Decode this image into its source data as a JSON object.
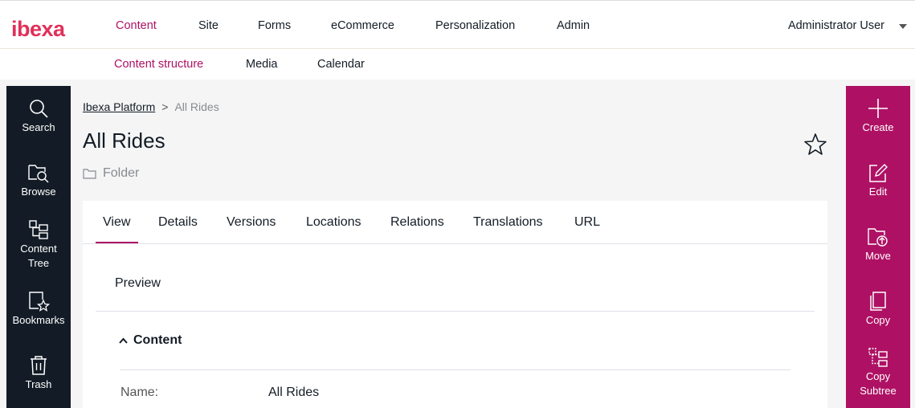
{
  "colors": {
    "accent": "#ae1164",
    "dark": "#131c26",
    "muted": "#878b90"
  },
  "header": {
    "logo_text": "ibexa",
    "nav": [
      "Content",
      "Site",
      "Forms",
      "eCommerce",
      "Personalization",
      "Admin"
    ],
    "user": "Administrator User"
  },
  "subnav": [
    "Content structure",
    "Media",
    "Calendar"
  ],
  "left_sidebar": {
    "items": [
      {
        "label": "Search",
        "icon": "search-icon"
      },
      {
        "label": "Browse",
        "icon": "browse-icon"
      },
      {
        "label": "Content Tree",
        "icon": "content-tree-icon"
      },
      {
        "label": "Bookmarks",
        "icon": "bookmarks-icon"
      },
      {
        "label": "Trash",
        "icon": "trash-icon"
      }
    ]
  },
  "right_sidebar": {
    "items": [
      {
        "label": "Create",
        "icon": "plus-icon"
      },
      {
        "label": "Edit",
        "icon": "edit-icon"
      },
      {
        "label": "Move",
        "icon": "move-icon"
      },
      {
        "label": "Copy",
        "icon": "copy-icon"
      },
      {
        "label": "Copy Subtree",
        "icon": "copy-subtree-icon"
      }
    ]
  },
  "breadcrumb": {
    "root": "Ibexa Platform",
    "separator": ">",
    "current": "All Rides"
  },
  "page": {
    "title": "All Rides",
    "content_type": "Folder"
  },
  "tabs": [
    "View",
    "Details",
    "Versions",
    "Locations",
    "Relations",
    "Translations",
    "URL"
  ],
  "view": {
    "preview_label": "Preview",
    "section_label": "Content",
    "fields": [
      {
        "label": "Name:",
        "value": "All Rides"
      }
    ]
  }
}
